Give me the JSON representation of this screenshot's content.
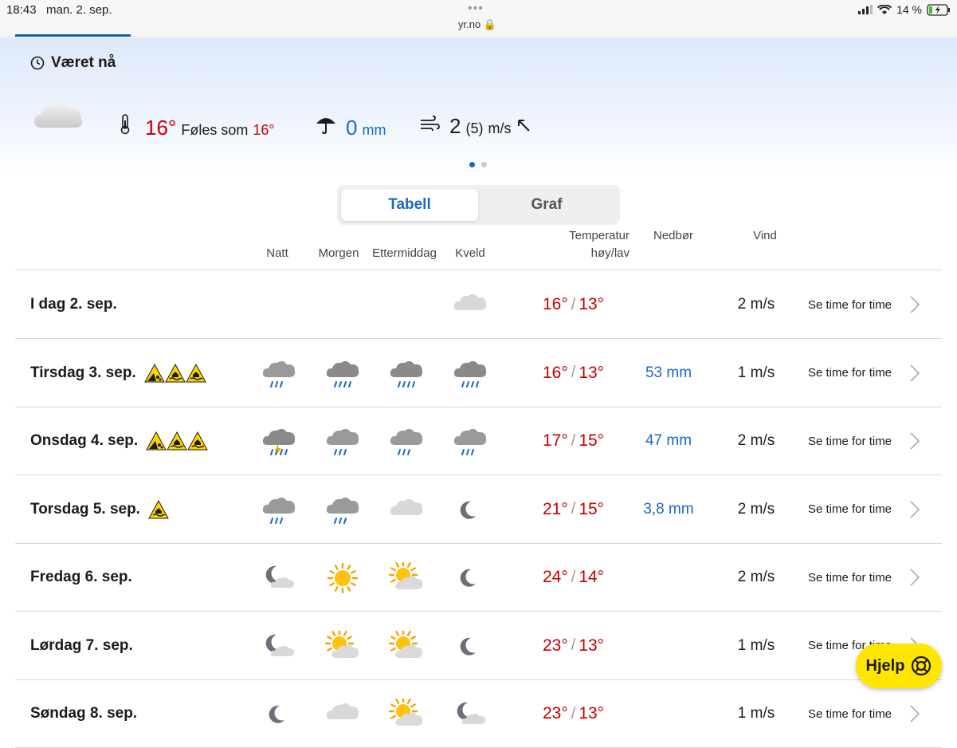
{
  "status_bar": {
    "time": "18:43",
    "date": "man. 2. sep.",
    "url": "yr.no",
    "battery": "14 %"
  },
  "now": {
    "title": "Været nå",
    "temperature": "16°",
    "feels_like_label": "Føles som",
    "feels_like": "16°",
    "precip_value": "0",
    "precip_unit": "mm",
    "wind_value": "2",
    "wind_gust": "(5)",
    "wind_unit": "m/s"
  },
  "tabs": {
    "table": "Tabell",
    "graph": "Graf"
  },
  "headers": {
    "night": "Natt",
    "morning": "Morgen",
    "afternoon": "Ettermiddag",
    "evening": "Kveld",
    "temp_line1": "Temperatur",
    "temp_line2": "høy/lav",
    "precip": "Nedbør",
    "wind": "Vind"
  },
  "rows": [
    {
      "day": "I dag 2. sep.",
      "warnings": [],
      "icons": [
        "",
        "",
        "",
        "cloud"
      ],
      "high": "16°",
      "low": "13°",
      "precip": "",
      "wind": "2 m/s",
      "link": "Se time for time"
    },
    {
      "day": "Tirsdag 3. sep.",
      "warnings": [
        "landslide",
        "flood",
        "flood"
      ],
      "icons": [
        "rain-light",
        "rain-heavy",
        "rain-heavy",
        "rain-heavy"
      ],
      "high": "16°",
      "low": "13°",
      "precip": "53 mm",
      "wind": "1 m/s",
      "link": "Se time for time"
    },
    {
      "day": "Onsdag 4. sep.",
      "warnings": [
        "landslide",
        "flood",
        "flood"
      ],
      "icons": [
        "thunder-rain",
        "rain",
        "rain",
        "rain"
      ],
      "high": "17°",
      "low": "15°",
      "precip": "47 mm",
      "wind": "2 m/s",
      "link": "Se time for time"
    },
    {
      "day": "Torsdag 5. sep.",
      "warnings": [
        "flood"
      ],
      "icons": [
        "rain",
        "rain",
        "cloud",
        "moon"
      ],
      "high": "21°",
      "low": "15°",
      "precip": "3,8 mm",
      "wind": "2 m/s",
      "link": "Se time for time"
    },
    {
      "day": "Fredag 6. sep.",
      "warnings": [],
      "icons": [
        "moon-cloud",
        "sun",
        "sun-cloud",
        "moon"
      ],
      "high": "24°",
      "low": "14°",
      "precip": "",
      "wind": "2 m/s",
      "link": "Se time for time"
    },
    {
      "day": "Lørdag 7. sep.",
      "warnings": [],
      "icons": [
        "moon-cloud",
        "sun-cloud",
        "sun-cloud",
        "moon"
      ],
      "high": "23°",
      "low": "13°",
      "precip": "",
      "wind": "1 m/s",
      "link": "Se time for time"
    },
    {
      "day": "Søndag 8. sep.",
      "warnings": [],
      "icons": [
        "moon",
        "cloud",
        "sun-cloud",
        "moon-cloud"
      ],
      "high": "23°",
      "low": "13°",
      "precip": "",
      "wind": "1 m/s",
      "link": "Se time for time"
    }
  ],
  "help_button": "Hjelp",
  "colors": {
    "temp": "#c60000",
    "precip": "#1a68c4",
    "accent": "#1a68c4",
    "help": "#ffe600"
  }
}
